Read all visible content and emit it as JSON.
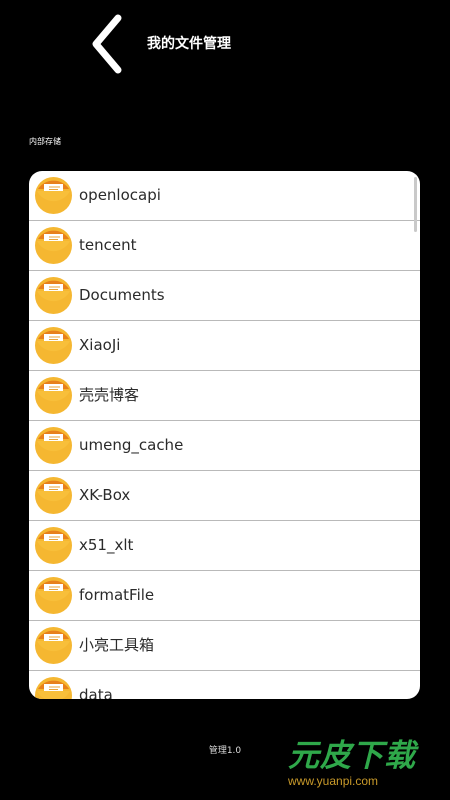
{
  "header": {
    "title": "我的文件管理",
    "back_icon": "chevron-left-icon"
  },
  "section": {
    "label": "内部存储"
  },
  "files": [
    {
      "name": "openlocapi",
      "icon": "folder-icon"
    },
    {
      "name": "tencent",
      "icon": "folder-icon"
    },
    {
      "name": "Documents",
      "icon": "folder-icon"
    },
    {
      "name": "XiaoJi",
      "icon": "folder-icon"
    },
    {
      "name": "壳壳博客",
      "icon": "folder-icon"
    },
    {
      "name": "umeng_cache",
      "icon": "folder-icon"
    },
    {
      "name": "XK-Box",
      "icon": "folder-icon"
    },
    {
      "name": "x51_xlt",
      "icon": "folder-icon"
    },
    {
      "name": "formatFile",
      "icon": "folder-icon"
    },
    {
      "name": "小亮工具箱",
      "icon": "folder-icon"
    },
    {
      "name": "data",
      "icon": "folder-icon"
    }
  ],
  "footer": {
    "version": "管理1.0"
  },
  "watermark": {
    "text": "元皮下载",
    "url": "www.yuanpi.com"
  },
  "colors": {
    "background": "#000000",
    "folder_orange": "#f5a623",
    "folder_dark": "#e8801a"
  }
}
